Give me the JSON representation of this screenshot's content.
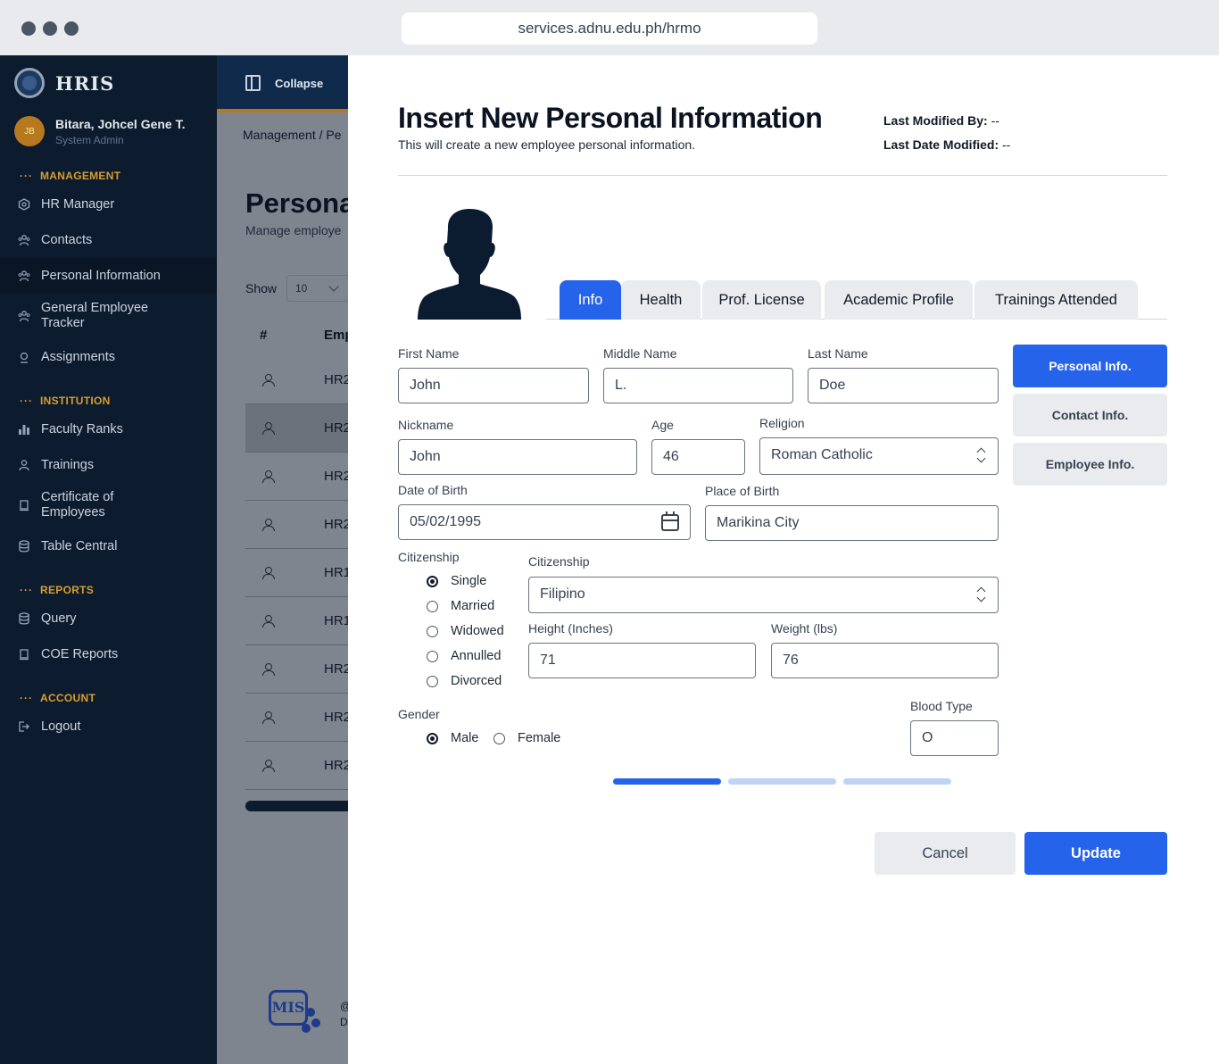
{
  "browser": {
    "url": "services.adnu.edu.ph/hrmo"
  },
  "sidebar": {
    "brand": "HRIS",
    "user": {
      "initials": "JB",
      "name": "Bitara, Johcel Gene T.",
      "role": "System Admin"
    },
    "sections": {
      "management": "MANAGEMENT",
      "institution": "INSTITUTION",
      "reports": "REPORTS",
      "account": "ACCOUNT"
    },
    "items": [
      {
        "label": "HR Manager",
        "icon": "hexagon-icon"
      },
      {
        "label": "Contacts",
        "icon": "people-icon"
      },
      {
        "label": "Personal Information",
        "icon": "people-icon",
        "active": true
      },
      {
        "label": "General Employee Tracker",
        "icon": "people-icon"
      },
      {
        "label": "Assignments",
        "icon": "pin-icon"
      },
      {
        "label": "Faculty Ranks",
        "icon": "bar-chart-icon"
      },
      {
        "label": "Trainings",
        "icon": "user-icon"
      },
      {
        "label": "Certificate of Employees",
        "icon": "document-icon"
      },
      {
        "label": "Table Central",
        "icon": "database-icon"
      },
      {
        "label": "Query",
        "icon": "database-icon"
      },
      {
        "label": "COE Reports",
        "icon": "document-icon"
      },
      {
        "label": "Logout",
        "icon": "logout-icon"
      }
    ]
  },
  "background_page": {
    "collapse_label": "Collapse",
    "breadcrumb": "Management / Pe",
    "title": "Persona",
    "subtitle": "Manage employe",
    "show_label": "Show",
    "show_value": "10",
    "columns": [
      "#",
      "Emp"
    ],
    "rows": [
      "HR2",
      "HR2",
      "HR2",
      "HR2",
      "HR1",
      "HR1",
      "HR2",
      "HR2",
      "HR2"
    ],
    "footer_logo_text": "MIS",
    "footer_text": [
      "@",
      "D"
    ]
  },
  "modal": {
    "title": "Insert New Personal Information",
    "subtitle": "This will create a new employee personal information.",
    "last_modified_by_label": "Last Modified By:",
    "last_modified_by_value": "--",
    "last_date_modified_label": "Last Date Modified:",
    "last_date_modified_value": "--",
    "tabs": [
      "Info",
      "Health",
      "Prof. License",
      "Academic Profile",
      "Trainings Attended"
    ],
    "active_tab": "Info",
    "side_buttons": [
      "Personal Info.",
      "Contact Info.",
      "Employee Info."
    ],
    "form": {
      "first_name": {
        "label": "First Name",
        "value": "John"
      },
      "middle_name": {
        "label": "Middle Name",
        "value": "L."
      },
      "last_name": {
        "label": "Last Name",
        "value": "Doe"
      },
      "nickname": {
        "label": "Nickname",
        "value": "John"
      },
      "age": {
        "label": "Age",
        "value": "46"
      },
      "religion": {
        "label": "Religion",
        "value": "Roman Catholic"
      },
      "dob": {
        "label": "Date of Birth",
        "value": "05/02/1995"
      },
      "pob": {
        "label": "Place of Birth",
        "value": "Marikina City"
      },
      "civil_status": {
        "label": "Citizenship",
        "options": [
          "Single",
          "Married",
          "Widowed",
          "Annulled",
          "Divorced"
        ],
        "selected": "Single"
      },
      "citizenship": {
        "label": "Citizenship",
        "value": "Filipino"
      },
      "height": {
        "label": "Height (Inches)",
        "value": "71"
      },
      "weight": {
        "label": "Weight (lbs)",
        "value": "76"
      },
      "gender": {
        "label": "Gender",
        "options": [
          "Male",
          "Female"
        ],
        "selected": "Male"
      },
      "blood_type": {
        "label": "Blood Type",
        "value": "O"
      }
    },
    "steps": {
      "total": 3,
      "current": 1
    },
    "cancel_label": "Cancel",
    "update_label": "Update"
  },
  "colors": {
    "primary": "#2563eb",
    "sidebar": "#0d1b2e",
    "accent": "#d69e2e"
  }
}
